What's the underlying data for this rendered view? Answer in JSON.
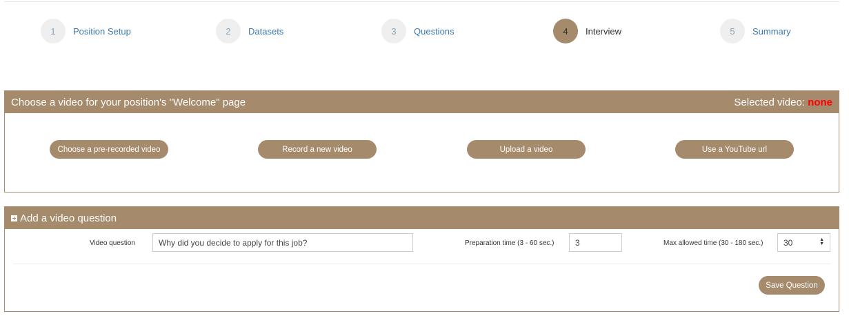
{
  "steps": [
    {
      "num": "1",
      "label": "Position Setup"
    },
    {
      "num": "2",
      "label": "Datasets"
    },
    {
      "num": "3",
      "label": "Questions"
    },
    {
      "num": "4",
      "label": "Interview"
    },
    {
      "num": "5",
      "label": "Summary"
    }
  ],
  "active_step": "4",
  "video_panel": {
    "title": "Choose a video for your position's \"Welcome\" page",
    "selected_label": "Selected video:",
    "selected_value": "none",
    "buttons": {
      "prerecorded": "Choose a pre-recorded video",
      "record": "Record a new video",
      "upload": "Upload a video",
      "youtube": "Use a YouTube url"
    }
  },
  "question_panel": {
    "title": "Add a video question",
    "video_question_label": "Video question",
    "video_question_value": "Why did you decide to apply for this job?",
    "prep_time_label": "Preparation time (3 - 60 sec.)",
    "prep_time_value": "3",
    "max_time_label": "Max allowed time (30 - 180 sec.)",
    "max_time_value": "30",
    "save_button": "Save Question"
  },
  "colors": {
    "accent": "#a58a6c",
    "link": "#3d7ab1",
    "alert": "#ff0000"
  }
}
